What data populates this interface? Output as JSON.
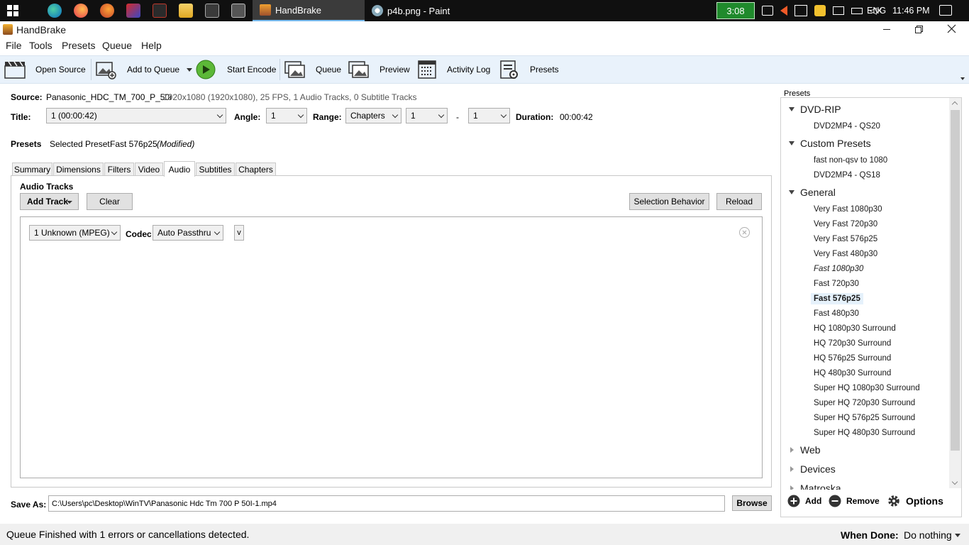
{
  "taskbar": {
    "tasks": [
      {
        "label": "HandBrake",
        "active": true
      },
      {
        "label": "p4b.png - Paint",
        "active": false
      }
    ],
    "tray": {
      "timer": "3:08",
      "language": "ENG",
      "clock": "11:46 PM"
    }
  },
  "window": {
    "title": "HandBrake"
  },
  "menu": [
    "File",
    "Tools",
    "Presets",
    "Queue",
    "Help"
  ],
  "toolbar": {
    "open_source": "Open Source",
    "add_to_queue": "Add to Queue",
    "start_encode": "Start Encode",
    "queue": "Queue",
    "preview": "Preview",
    "activity_log": "Activity Log",
    "presets": "Presets"
  },
  "source": {
    "label": "Source:",
    "name": "Panasonic_HDC_TM_700_P_50i",
    "info": "1920x1080 (1920x1080), 25 FPS, 1 Audio Tracks, 0 Subtitle Tracks"
  },
  "title_row": {
    "title_label": "Title:",
    "title_value": "1 (00:00:42)",
    "angle_label": "Angle:",
    "angle_value": "1",
    "range_label": "Range:",
    "range_type": "Chapters",
    "range_from": "1",
    "range_dash": "-",
    "range_to": "1",
    "duration_label": "Duration:",
    "duration_value": "00:00:42"
  },
  "preset_row": {
    "label": "Presets",
    "selected_label": "Selected Preset:",
    "selected_value": "Fast 576p25",
    "modified": "(Modified)"
  },
  "tabs": [
    "Summary",
    "Dimensions",
    "Filters",
    "Video",
    "Audio",
    "Subtitles",
    "Chapters"
  ],
  "active_tab": "Audio",
  "audio": {
    "section_title": "Audio Tracks",
    "add_track": "Add Track",
    "clear": "Clear",
    "selection_behavior": "Selection Behavior",
    "reload": "Reload",
    "track": {
      "source": "1 Unknown (MPEG)",
      "codec_label": "Codec",
      "codec_value": "Auto Passthru",
      "expand": "v"
    }
  },
  "save_as": {
    "label": "Save As:",
    "path": "C:\\Users\\pc\\Desktop\\WinTV\\Panasonic Hdc Tm 700 P 50I-1.mp4",
    "browse": "Browse"
  },
  "presets_panel": {
    "title": "Presets",
    "groups": [
      {
        "name": "DVD-RIP",
        "items": [
          "DVD2MP4 - QS20"
        ]
      },
      {
        "name": "Custom Presets",
        "items": [
          "fast non-qsv to 1080",
          "DVD2MP4 - QS18"
        ]
      },
      {
        "name": "General",
        "items": [
          "Very Fast 1080p30",
          "Very Fast 720p30",
          "Very Fast 576p25",
          "Very Fast 480p30",
          "Fast 1080p30",
          "Fast 720p30",
          "Fast 576p25",
          "Fast 480p30",
          "HQ 1080p30 Surround",
          "HQ 720p30 Surround",
          "HQ 576p25 Surround",
          "HQ 480p30 Surround",
          "Super HQ 1080p30 Surround",
          "Super HQ 720p30 Surround",
          "Super HQ 576p25 Surround",
          "Super HQ 480p30 Surround"
        ]
      }
    ],
    "collapsed_groups": [
      "Web",
      "Devices",
      "Matroska"
    ],
    "selected_item": "Fast 576p25",
    "italic_item": "Fast 1080p30",
    "add": "Add",
    "remove": "Remove",
    "options": "Options"
  },
  "status": {
    "message": "Queue Finished with 1 errors or cancellations detected.",
    "when_done_label": "When Done:",
    "when_done_value": "Do nothing"
  }
}
